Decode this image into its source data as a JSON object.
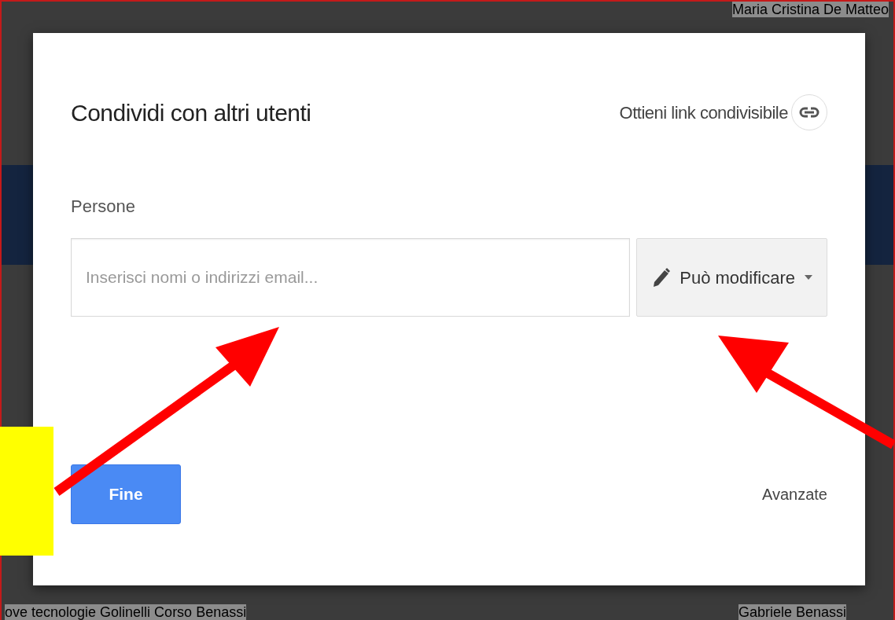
{
  "background": {
    "top_text": "Maria Cristina De Matteo",
    "bottom_left_text": "ove tecnologie Golinelli Corso Benassi",
    "bottom_right_text": "Gabriele Benassi"
  },
  "dialog": {
    "title": "Condividi con altri utenti",
    "share_link": {
      "label": "Ottieni link condivisibile"
    },
    "people_label": "Persone",
    "people_input": {
      "placeholder": "Inserisci nomi o indirizzi email..."
    },
    "permission_dropdown": {
      "label": "Può modificare"
    },
    "done_button": "Fine",
    "advanced_link": "Avanzate"
  }
}
